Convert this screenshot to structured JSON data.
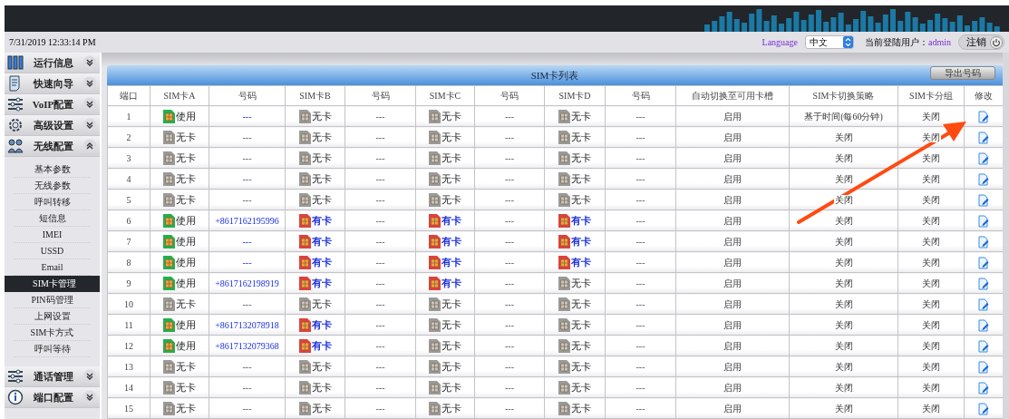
{
  "datetime": "7/31/2019 12:33:14 PM",
  "language": {
    "label": "Language",
    "value": "中文"
  },
  "user": {
    "label": "当前登陆用户：",
    "name": "admin"
  },
  "logout": "注销",
  "sidebar": [
    {
      "label": "运行信息",
      "expanded": false
    },
    {
      "label": "快速向导",
      "expanded": false
    },
    {
      "label": "VoIP配置",
      "expanded": false
    },
    {
      "label": "高级设置",
      "expanded": false
    },
    {
      "label": "无线配置",
      "expanded": true,
      "children": [
        {
          "label": "基本参数",
          "selected": false
        },
        {
          "label": "无线参数",
          "selected": false
        },
        {
          "label": "呼叫转移",
          "selected": false
        },
        {
          "label": "短信息",
          "selected": false
        },
        {
          "label": "IMEI",
          "selected": false
        },
        {
          "label": "USSD",
          "selected": false
        },
        {
          "label": "Email",
          "selected": false
        },
        {
          "label": "SIM卡管理",
          "selected": true
        },
        {
          "label": "PIN码管理",
          "selected": false
        },
        {
          "label": "上网设置",
          "selected": false
        },
        {
          "label": "SIM卡方式",
          "selected": false
        },
        {
          "label": "呼叫等待",
          "selected": false
        }
      ]
    },
    {
      "label": "通话管理",
      "expanded": false
    },
    {
      "label": "端口配置",
      "expanded": false
    }
  ],
  "table": {
    "title": "SIM卡列表",
    "export_button": "导出号码",
    "columns": [
      "端口",
      "SIM卡A",
      "号码",
      "SIM卡B",
      "号码",
      "SIM卡C",
      "号码",
      "SIM卡D",
      "号码",
      "自动切换至可用卡槽",
      "SIM卡切换策略",
      "SIM卡分组",
      "修改"
    ],
    "rows": [
      {
        "port": "1",
        "cards": [
          {
            "kind": "using",
            "label": "使用",
            "number": "---"
          },
          {
            "kind": "none",
            "label": "无卡",
            "number": "---"
          },
          {
            "kind": "none",
            "label": "无卡",
            "number": "---"
          },
          {
            "kind": "none",
            "label": "无卡",
            "number": "---"
          }
        ],
        "auto_switch": "启用",
        "strategy": "基于时间(每60分钟)",
        "group": "关闭"
      },
      {
        "port": "2",
        "cards": [
          {
            "kind": "none",
            "label": "无卡",
            "number": "---"
          },
          {
            "kind": "none",
            "label": "无卡",
            "number": "---"
          },
          {
            "kind": "none",
            "label": "无卡",
            "number": "---"
          },
          {
            "kind": "none",
            "label": "无卡",
            "number": "---"
          }
        ],
        "auto_switch": "启用",
        "strategy": "关闭",
        "group": "关闭"
      },
      {
        "port": "3",
        "cards": [
          {
            "kind": "none",
            "label": "无卡",
            "number": "---"
          },
          {
            "kind": "none",
            "label": "无卡",
            "number": "---"
          },
          {
            "kind": "none",
            "label": "无卡",
            "number": "---"
          },
          {
            "kind": "none",
            "label": "无卡",
            "number": "---"
          }
        ],
        "auto_switch": "启用",
        "strategy": "关闭",
        "group": "关闭"
      },
      {
        "port": "4",
        "cards": [
          {
            "kind": "none",
            "label": "无卡",
            "number": "---"
          },
          {
            "kind": "none",
            "label": "无卡",
            "number": "---"
          },
          {
            "kind": "none",
            "label": "无卡",
            "number": "---"
          },
          {
            "kind": "none",
            "label": "无卡",
            "number": "---"
          }
        ],
        "auto_switch": "启用",
        "strategy": "关闭",
        "group": "关闭"
      },
      {
        "port": "5",
        "cards": [
          {
            "kind": "none",
            "label": "无卡",
            "number": "---"
          },
          {
            "kind": "none",
            "label": "无卡",
            "number": "---"
          },
          {
            "kind": "none",
            "label": "无卡",
            "number": "---"
          },
          {
            "kind": "none",
            "label": "无卡",
            "number": "---"
          }
        ],
        "auto_switch": "启用",
        "strategy": "关闭",
        "group": "关闭"
      },
      {
        "port": "6",
        "cards": [
          {
            "kind": "using",
            "label": "使用",
            "number": "+8617162195996"
          },
          {
            "kind": "present",
            "label": "有卡",
            "number": "---"
          },
          {
            "kind": "present",
            "label": "有卡",
            "number": "---"
          },
          {
            "kind": "present",
            "label": "有卡",
            "number": "---"
          }
        ],
        "auto_switch": "启用",
        "strategy": "关闭",
        "group": "关闭"
      },
      {
        "port": "7",
        "cards": [
          {
            "kind": "using",
            "label": "使用",
            "number": "---"
          },
          {
            "kind": "present",
            "label": "有卡",
            "number": "---"
          },
          {
            "kind": "present",
            "label": "有卡",
            "number": "---"
          },
          {
            "kind": "present",
            "label": "有卡",
            "number": "---"
          }
        ],
        "auto_switch": "启用",
        "strategy": "关闭",
        "group": "关闭"
      },
      {
        "port": "8",
        "cards": [
          {
            "kind": "using",
            "label": "使用",
            "number": "---"
          },
          {
            "kind": "present",
            "label": "有卡",
            "number": "---"
          },
          {
            "kind": "present",
            "label": "有卡",
            "number": "---"
          },
          {
            "kind": "present",
            "label": "有卡",
            "number": "---"
          }
        ],
        "auto_switch": "启用",
        "strategy": "关闭",
        "group": "关闭"
      },
      {
        "port": "9",
        "cards": [
          {
            "kind": "using",
            "label": "使用",
            "number": "+8617162198919"
          },
          {
            "kind": "present",
            "label": "有卡",
            "number": "---"
          },
          {
            "kind": "present",
            "label": "有卡",
            "number": "---"
          },
          {
            "kind": "none",
            "label": "无卡",
            "number": "---"
          }
        ],
        "auto_switch": "启用",
        "strategy": "关闭",
        "group": "关闭"
      },
      {
        "port": "10",
        "cards": [
          {
            "kind": "none",
            "label": "无卡",
            "number": "---"
          },
          {
            "kind": "none",
            "label": "无卡",
            "number": "---"
          },
          {
            "kind": "none",
            "label": "无卡",
            "number": "---"
          },
          {
            "kind": "none",
            "label": "无卡",
            "number": "---"
          }
        ],
        "auto_switch": "启用",
        "strategy": "关闭",
        "group": "关闭"
      },
      {
        "port": "11",
        "cards": [
          {
            "kind": "using",
            "label": "使用",
            "number": "+8617132078918"
          },
          {
            "kind": "present",
            "label": "有卡",
            "number": "---"
          },
          {
            "kind": "none",
            "label": "无卡",
            "number": "---"
          },
          {
            "kind": "none",
            "label": "无卡",
            "number": "---"
          }
        ],
        "auto_switch": "启用",
        "strategy": "关闭",
        "group": "关闭"
      },
      {
        "port": "12",
        "cards": [
          {
            "kind": "using",
            "label": "使用",
            "number": "+8617132079368"
          },
          {
            "kind": "present",
            "label": "有卡",
            "number": "---"
          },
          {
            "kind": "none",
            "label": "无卡",
            "number": "---"
          },
          {
            "kind": "none",
            "label": "无卡",
            "number": "---"
          }
        ],
        "auto_switch": "启用",
        "strategy": "关闭",
        "group": "关闭"
      },
      {
        "port": "13",
        "cards": [
          {
            "kind": "none",
            "label": "无卡",
            "number": "---"
          },
          {
            "kind": "none",
            "label": "无卡",
            "number": "---"
          },
          {
            "kind": "none",
            "label": "无卡",
            "number": "---"
          },
          {
            "kind": "none",
            "label": "无卡",
            "number": "---"
          }
        ],
        "auto_switch": "启用",
        "strategy": "关闭",
        "group": "关闭"
      },
      {
        "port": "14",
        "cards": [
          {
            "kind": "none",
            "label": "无卡",
            "number": "---"
          },
          {
            "kind": "none",
            "label": "无卡",
            "number": "---"
          },
          {
            "kind": "none",
            "label": "无卡",
            "number": "---"
          },
          {
            "kind": "none",
            "label": "无卡",
            "number": "---"
          }
        ],
        "auto_switch": "启用",
        "strategy": "关闭",
        "group": "关闭"
      },
      {
        "port": "15",
        "cards": [
          {
            "kind": "none",
            "label": "无卡",
            "number": "---"
          },
          {
            "kind": "none",
            "label": "无卡",
            "number": "---"
          },
          {
            "kind": "none",
            "label": "无卡",
            "number": "---"
          },
          {
            "kind": "none",
            "label": "无卡",
            "number": "---"
          }
        ],
        "auto_switch": "启用",
        "strategy": "关闭",
        "group": "关闭"
      }
    ]
  },
  "annotation": {
    "kind": "arrow"
  }
}
